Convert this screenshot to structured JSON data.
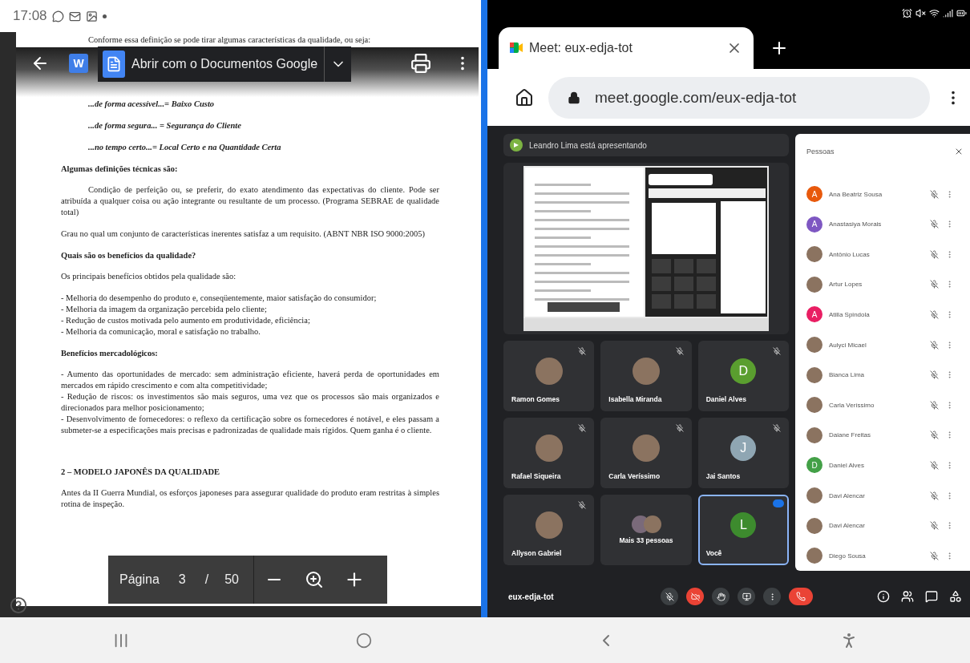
{
  "status_bar": {
    "time": "17:08"
  },
  "document": {
    "file_badge": "W",
    "open_with": "Abrir com o Documentos Google",
    "paragraphs": [
      {
        "kind": "lead",
        "text": "Conforme essa definição se pode tirar algumas características da qualidade, ou seja:"
      },
      {
        "kind": "emphasis",
        "text": "...de forma acessível...= Baixo Custo"
      },
      {
        "kind": "emphasis",
        "text": "...de forma segura... = Segurança do Cliente"
      },
      {
        "kind": "emphasis",
        "text": "...no tempo certo...= Local Certo e na Quantidade Certa"
      },
      {
        "kind": "heading",
        "text": "Algumas definições técnicas são:"
      },
      {
        "kind": "indented",
        "text": "Condição de perfeição ou, se preferir, do exato atendimento das expectativas do cliente. Pode ser atribuída a qualquer coisa ou ação integrante ou resultante de um processo. (Programa SEBRAE de qualidade total)"
      },
      {
        "kind": "paragraph",
        "text": "Grau no qual um conjunto de características inerentes satisfaz a um requisito. (ABNT NBR ISO 9000:2005)"
      },
      {
        "kind": "heading",
        "text": "Quais são os benefícios da qualidade?"
      },
      {
        "kind": "paragraph",
        "text": "Os principais benefícios obtidos pela qualidade são:"
      },
      {
        "kind": "line",
        "text": "- Melhoria do desempenho do produto e, conseqüentemente, maior satisfação do consumidor;"
      },
      {
        "kind": "line",
        "text": "- Melhoria da imagem da organização percebida pelo cliente;"
      },
      {
        "kind": "line",
        "text": "- Redução de custos motivada pelo aumento em produtividade, eficiência;"
      },
      {
        "kind": "line",
        "text": "- Melhoria da comunicação, moral e satisfação no trabalho."
      },
      {
        "kind": "heading",
        "text": "Benefícios mercadológicos:"
      },
      {
        "kind": "line",
        "text": "- Aumento das oportunidades de mercado: sem administração eficiente, haverá perda de oportunidades em mercados em rápido crescimento e com alta competitividade;"
      },
      {
        "kind": "line",
        "text": "- Redução de riscos: os investimentos são mais seguros, uma vez que os processos são mais organizados e direcionados para melhor posicionamento;"
      },
      {
        "kind": "line",
        "text": "- Desenvolvimento de fornecedores: o reflexo da certificação sobre os fornecedores é notável, e eles passam a submeter-se a especificações mais precisas e padronizadas de qualidade mais rígidos. Quem ganha é o cliente."
      },
      {
        "kind": "section",
        "text": "2 – MODELO JAPONÊS DA QUALIDADE"
      },
      {
        "kind": "paragraph",
        "text": "Antes da II Guerra Mundial, os esforços japoneses para assegurar qualidade do produto eram restritas à simples rotina de inspeção."
      }
    ],
    "page_nav": {
      "label": "Página",
      "page": "3",
      "separator": "/",
      "total": "50"
    }
  },
  "browser": {
    "tab_title": "Meet: eux-edja-tot",
    "url": "meet.google.com/eux-edja-tot"
  },
  "meet": {
    "presenter_banner": "Leandro Lima está apresentando",
    "tiles": [
      {
        "kind": "photo",
        "name": "Ramon Gomes",
        "selected": false
      },
      {
        "kind": "photo",
        "name": "Isabella Miranda",
        "selected": false
      },
      {
        "kind": "letter",
        "name": "Daniel Alves",
        "letter": "D",
        "color": "#5a9e2f",
        "selected": false
      },
      {
        "kind": "photo",
        "name": "Rafael Siqueira",
        "selected": false
      },
      {
        "kind": "photo",
        "name": "Carla Veríssimo",
        "selected": false
      },
      {
        "kind": "letter",
        "name": "Jai Santos",
        "letter": "J",
        "color": "#8fa6b3",
        "selected": false
      },
      {
        "kind": "photo",
        "name": "Allyson Gabriel",
        "selected": false
      },
      {
        "kind": "more",
        "name": "Mais 33 pessoas",
        "selected": false
      },
      {
        "kind": "letter",
        "name": "Você",
        "letter": "L",
        "color": "#3d8b2e",
        "selected": true
      }
    ],
    "meeting_code": "eux-edja-tot",
    "people": {
      "title": "Pessoas",
      "items": [
        {
          "kind": "letter",
          "name": "Ana Beatriz Sousa",
          "letter": "A",
          "color": "#e8590c"
        },
        {
          "kind": "letter",
          "name": "Anastasiya Morais",
          "letter": "A",
          "color": "#7e57c2"
        },
        {
          "kind": "photo",
          "name": "Antônio Lucas"
        },
        {
          "kind": "photo",
          "name": "Artur Lopes"
        },
        {
          "kind": "letter",
          "name": "Atilla Spindola",
          "letter": "A",
          "color": "#e91e63"
        },
        {
          "kind": "photo",
          "name": "Aulyci Micael"
        },
        {
          "kind": "photo",
          "name": "Bianca Lima"
        },
        {
          "kind": "photo",
          "name": "Carla Veríssimo"
        },
        {
          "kind": "photo",
          "name": "Daiane Freitas"
        },
        {
          "kind": "letter",
          "name": "Daniel Alves",
          "letter": "D",
          "color": "#43a047"
        },
        {
          "kind": "photo",
          "name": "Davi Alencar"
        },
        {
          "kind": "photo",
          "name": "Davi Alencar"
        },
        {
          "kind": "photo",
          "name": "Diego Sousa"
        }
      ]
    }
  }
}
